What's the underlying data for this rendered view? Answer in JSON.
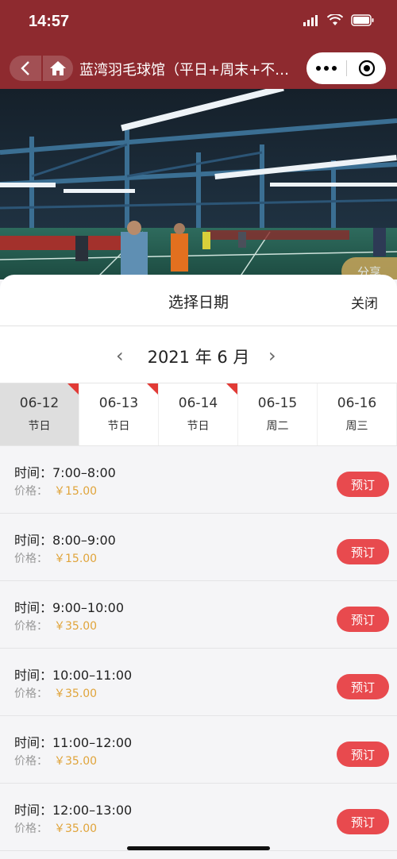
{
  "status_bar": {
    "time": "14:57"
  },
  "nav": {
    "title": "蓝湾羽毛球馆（平日+周末+不…"
  },
  "hero": {
    "share_label": "分享"
  },
  "sheet": {
    "title": "选择日期",
    "close_label": "关闭",
    "month_label": "2021 年 6 月",
    "prev_icon": "‹",
    "next_icon": "›"
  },
  "days": [
    {
      "date": "06-12",
      "label": "节日"
    },
    {
      "date": "06-13",
      "label": "节日"
    },
    {
      "date": "06-14",
      "label": "节日"
    },
    {
      "date": "06-15",
      "label": "周二"
    },
    {
      "date": "06-16",
      "label": "周三"
    }
  ],
  "slots": [
    {
      "time": "时间：7:00–8:00",
      "price_label": "价格：",
      "price": "￥15.00",
      "button": "预订"
    },
    {
      "time": "时间：8:00–9:00",
      "price_label": "价格：",
      "price": "￥15.00",
      "button": "预订"
    },
    {
      "time": "时间：9:00–10:00",
      "price_label": "价格：",
      "price": "￥35.00",
      "button": "预订"
    },
    {
      "time": "时间：10:00–11:00",
      "price_label": "价格：",
      "price": "￥35.00",
      "button": "预订"
    },
    {
      "time": "时间：11:00–12:00",
      "price_label": "价格：",
      "price": "￥35.00",
      "button": "预订"
    },
    {
      "time": "时间：12:00–13:00",
      "price_label": "价格：",
      "price": "￥35.00",
      "button": "预订"
    }
  ],
  "colors": {
    "brand": "#8e2a2f",
    "accent_red": "#e84a4e",
    "price": "#e0a43a"
  }
}
